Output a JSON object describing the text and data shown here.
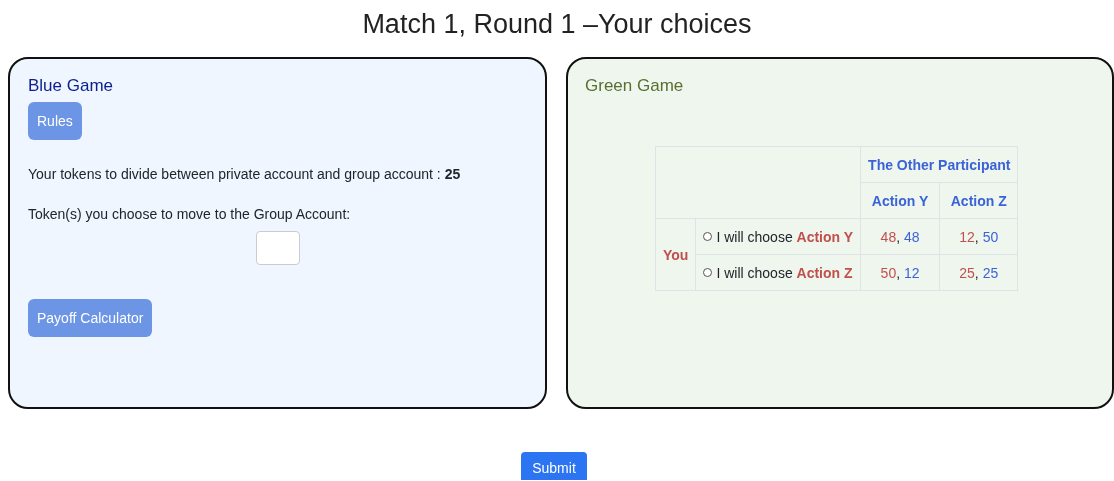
{
  "page_title": "Match 1, Round 1 –Your choices",
  "blue_game": {
    "title": "Blue Game",
    "rules_button": "Rules",
    "tokens_text": "Your tokens to divide between private account and group account : **25**",
    "move_label": "Token(s) you choose to move to the Group Account:",
    "calculator_button": "Payoff Calculator"
  },
  "green_game": {
    "title": "Green Game",
    "other_header": "The Other Participant",
    "columns": [
      "Action Y",
      "Action Z"
    ],
    "row_header": "You",
    "rows": [
      {
        "choice": "I will choose **Action Y**",
        "selected": false,
        "payoffs": [
          {
            "you": "48",
            "sep": ",",
            "other": "48"
          },
          {
            "you": "12",
            "sep": ",",
            "other": "50"
          }
        ]
      },
      {
        "choice": "I will choose **Action Z**",
        "selected": false,
        "payoffs": [
          {
            "you": "50",
            "sep": ",",
            "other": "12"
          },
          {
            "you": "25",
            "sep": ",",
            "other": "25"
          }
        ]
      }
    ]
  },
  "submit_button": "Submit"
}
